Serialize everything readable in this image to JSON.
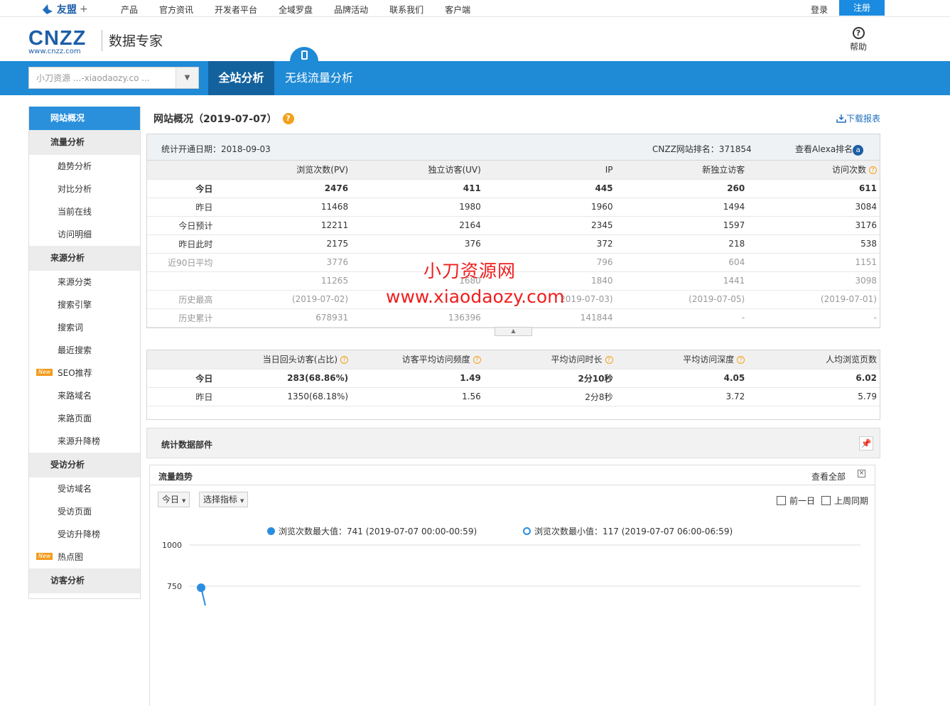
{
  "topbar": {
    "logo": "友盟",
    "logo_plus": "+",
    "nav": [
      "产品",
      "官方资讯",
      "开发者平台",
      "全域罗盘",
      "品牌活动",
      "联系我们",
      "客户端"
    ],
    "login": "登录",
    "register": "注册"
  },
  "header": {
    "brand": "CNZZ",
    "brand_url": "www.cnzz.com",
    "product": "数据专家",
    "help": "帮助",
    "help_icon": "?"
  },
  "bluebar": {
    "site_select_value": "小刀资源 ...-xiaodaozy.co ...",
    "tab_all": "全站分析",
    "tab_wireless": "无线流量分析"
  },
  "sidebar": {
    "active": "网站概况",
    "groups": [
      {
        "label": "流量分析",
        "items": [
          {
            "label": "趋势分析"
          },
          {
            "label": "对比分析"
          },
          {
            "label": "当前在线"
          },
          {
            "label": "访问明细"
          }
        ]
      },
      {
        "label": "来源分析",
        "items": [
          {
            "label": "来源分类"
          },
          {
            "label": "搜索引擎"
          },
          {
            "label": "搜索词"
          },
          {
            "label": "最近搜索"
          },
          {
            "label": "SEO推荐",
            "new": "New"
          },
          {
            "label": "来路域名"
          },
          {
            "label": "来路页面"
          },
          {
            "label": "来源升降榜"
          }
        ]
      },
      {
        "label": "受访分析",
        "items": [
          {
            "label": "受访域名"
          },
          {
            "label": "受访页面"
          },
          {
            "label": "受访升降榜"
          },
          {
            "label": "热点图",
            "new": "New"
          }
        ]
      },
      {
        "label": "访客分析",
        "items": []
      }
    ]
  },
  "main": {
    "title": "网站概况（2019-07-07）",
    "download": "下载报表",
    "since": "统计开通日期：2018-09-03",
    "rank": "CNZZ网站排名：371854",
    "alexa": "查看Alexa排名",
    "table1": {
      "headers": [
        "",
        "浏览次数(PV)",
        "独立访客(UV)",
        "IP",
        "新独立访客",
        "访问次数"
      ],
      "rows": [
        {
          "style": "bold",
          "cells": [
            "今日",
            "2476",
            "411",
            "445",
            "260",
            "611"
          ]
        },
        {
          "style": "normal",
          "cells": [
            "昨日",
            "11468",
            "1980",
            "1960",
            "1494",
            "3084"
          ]
        },
        {
          "style": "normal",
          "cells": [
            "今日预计",
            "12211",
            "2164",
            "2345",
            "1597",
            "3176"
          ]
        },
        {
          "style": "normal",
          "cells": [
            "昨日此时",
            "2175",
            "376",
            "372",
            "218",
            "538"
          ]
        },
        {
          "style": "dim",
          "cells": [
            "近90日平均",
            "3776",
            "",
            "796",
            "604",
            "1151"
          ]
        },
        {
          "style": "dim",
          "cells": [
            "",
            "11265",
            "1680",
            "1840",
            "1441",
            "3098"
          ]
        },
        {
          "style": "dim",
          "cells": [
            "历史最高",
            "(2019-07-02)",
            "",
            "2019-07-03)",
            "(2019-07-05)",
            "(2019-07-01)"
          ]
        },
        {
          "style": "dim",
          "cells": [
            "历史累计",
            "678931",
            "136396",
            "141844",
            "-",
            "-"
          ]
        }
      ]
    },
    "table2": {
      "headers": [
        "",
        "当日回头访客(占比)",
        "访客平均访问频度",
        "平均访问时长",
        "平均访问深度",
        "人均浏览页数"
      ],
      "rows": [
        {
          "style": "bold",
          "cells": [
            "今日",
            "283(68.86%)",
            "1.49",
            "2分10秒",
            "4.05",
            "6.02"
          ]
        },
        {
          "style": "normal",
          "cells": [
            "昨日",
            "1350(68.18%)",
            "1.56",
            "2分8秒",
            "3.72",
            "5.79"
          ]
        }
      ]
    },
    "widget_title": "统计数据部件",
    "trend": {
      "title": "流量趋势",
      "view_all": "查看全部",
      "period": "今日",
      "metric": "选择指标",
      "prev_day": "前一日",
      "last_week": "上周同期",
      "legend_max": "浏览次数最大值：741 (2019-07-07 00:00-00:59)",
      "legend_min": "浏览次数最小值：117 (2019-07-07 06:00-06:59)"
    }
  },
  "watermark": {
    "line1": "小刀资源网",
    "line2": "www.xiaodaozy.com"
  },
  "chart_data": {
    "type": "line",
    "title": "",
    "xlabel": "",
    "ylabel": "",
    "ylim": [
      0,
      1000
    ],
    "yticks": [
      1000,
      750
    ],
    "series": [
      {
        "name": "浏览次数",
        "values": [
          741
        ]
      }
    ],
    "colors": {
      "line": "#2a8ee0"
    }
  },
  "colors": {
    "accent": "#1f8ad6",
    "tab_active": "#13629e",
    "sidebar_active": "#2a90dc",
    "warning": "#f5a01a",
    "watermark": "#f01e1e"
  }
}
